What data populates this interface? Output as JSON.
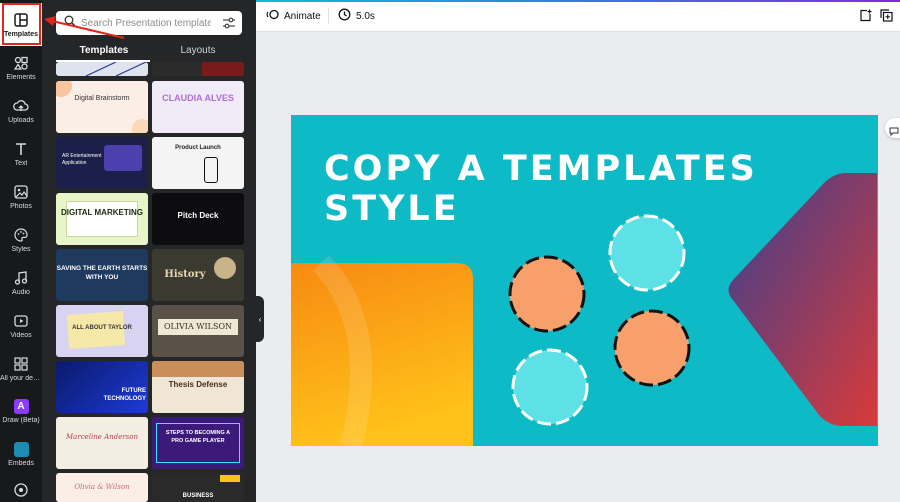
{
  "rail": {
    "items": [
      {
        "label": "Templates",
        "icon": "templates-icon"
      },
      {
        "label": "Elements",
        "icon": "elements-icon"
      },
      {
        "label": "Uploads",
        "icon": "uploads-icon"
      },
      {
        "label": "Text",
        "icon": "text-icon"
      },
      {
        "label": "Photos",
        "icon": "photos-icon"
      },
      {
        "label": "Styles",
        "icon": "styles-icon"
      },
      {
        "label": "Audio",
        "icon": "audio-icon"
      },
      {
        "label": "Videos",
        "icon": "videos-icon"
      },
      {
        "label": "All your desi...",
        "icon": "apps-icon"
      },
      {
        "label": "Draw (Beta)",
        "icon": "draw-icon"
      },
      {
        "label": "Embeds",
        "icon": "embeds-icon"
      }
    ]
  },
  "search": {
    "placeholder": "Search Presentation templates"
  },
  "tabs": {
    "templates": "Templates",
    "layouts": "Layouts"
  },
  "thumbs": {
    "t1": "Digital Brainstorm",
    "t2": "CLAUDIA ALVES",
    "t3": "AR Entertainment Application",
    "t4": "Product Launch",
    "t5": "DIGITAL MARKETING",
    "t6": "Pitch Deck",
    "t7": "SAVING THE EARTH STARTS WITH YOU",
    "t8": "History",
    "t9": "ALL ABOUT TAYLOR",
    "t10": "OLIVIA WILSON",
    "t11": "FUTURE TECHNOLOGY",
    "t12": "Thesis Defense",
    "t13": "Marceline Anderson",
    "t14": "STEPS TO BECOMING A PRO GAME PLAYER",
    "t15": "Olivia & Wilson",
    "t16": "BUSINESS"
  },
  "topbar": {
    "animate_label": "Animate",
    "duration_label": "5.0s"
  },
  "slide": {
    "title_line1": "COPY A TEMPLATES",
    "title_line2": "STYLE"
  },
  "colors": {
    "accent_red": "#e1261c",
    "slide_bg": "#0dbac6",
    "peach": "#f7a06b",
    "light_cyan": "#5de0e6"
  }
}
